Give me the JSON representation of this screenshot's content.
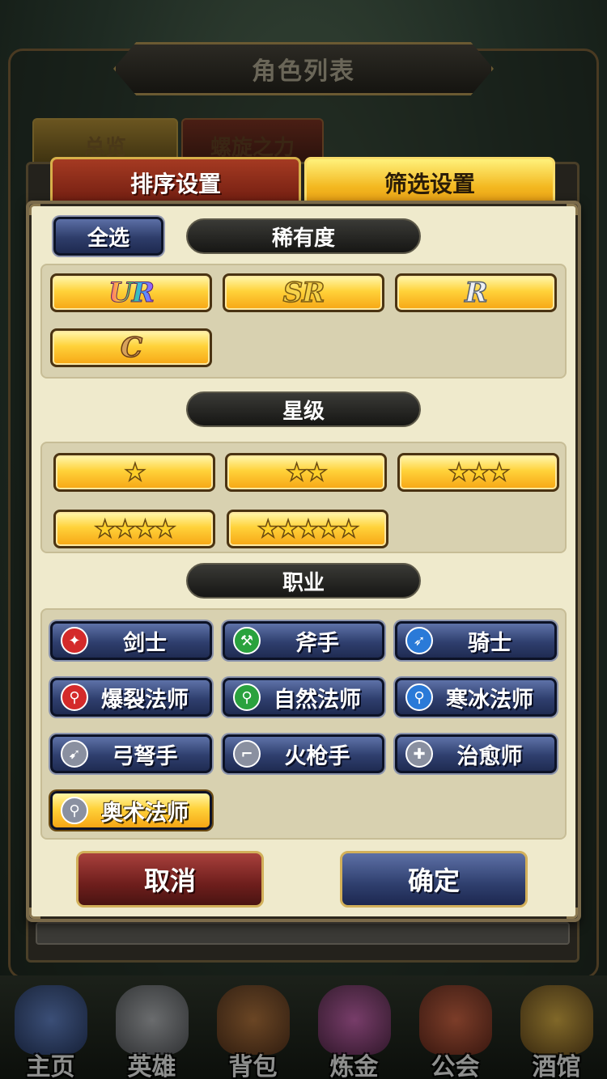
{
  "header": {
    "title": "角色列表"
  },
  "background_tabs": [
    {
      "label": "总览"
    },
    {
      "label": "螺旋之力"
    }
  ],
  "dialog": {
    "tabs": [
      {
        "label": "排序设置",
        "active": false
      },
      {
        "label": "筛选设置",
        "active": true
      }
    ],
    "select_all_label": "全选",
    "rarity": {
      "header": "稀有度",
      "options": [
        {
          "label": "UR",
          "selected": true
        },
        {
          "label": "SR",
          "selected": true
        },
        {
          "label": "R",
          "selected": true
        },
        {
          "label": "C",
          "selected": true
        }
      ]
    },
    "stars": {
      "header": "星级",
      "options": [
        {
          "label": "★",
          "count": 1,
          "selected": true
        },
        {
          "label": "★★",
          "count": 2,
          "selected": true
        },
        {
          "label": "★★★",
          "count": 3,
          "selected": true
        },
        {
          "label": "★★★★",
          "count": 4,
          "selected": true
        },
        {
          "label": "★★★★★",
          "count": 5,
          "selected": true
        }
      ]
    },
    "classes": {
      "header": "职业",
      "options": [
        {
          "label": "剑士",
          "icon": "sword-icon",
          "color": "#d42a2a",
          "glyph": "✦",
          "selected": false
        },
        {
          "label": "斧手",
          "icon": "axe-icon",
          "color": "#2aa23e",
          "glyph": "⚒",
          "selected": false
        },
        {
          "label": "骑士",
          "icon": "lance-icon",
          "color": "#2a7ad8",
          "glyph": "➶",
          "selected": false
        },
        {
          "label": "爆裂法师",
          "icon": "red-staff-icon",
          "color": "#d42a2a",
          "glyph": "⚲",
          "selected": false
        },
        {
          "label": "自然法师",
          "icon": "green-staff-icon",
          "color": "#2aa23e",
          "glyph": "⚲",
          "selected": false
        },
        {
          "label": "寒冰法师",
          "icon": "blue-staff-icon",
          "color": "#2a7ad8",
          "glyph": "⚲",
          "selected": false
        },
        {
          "label": "弓弩手",
          "icon": "bow-icon",
          "color": "#8a90a0",
          "glyph": "➹",
          "selected": false
        },
        {
          "label": "火枪手",
          "icon": "gun-icon",
          "color": "#8a90a0",
          "glyph": "⌐",
          "selected": false
        },
        {
          "label": "治愈师",
          "icon": "heal-staff-icon",
          "color": "#8a90a0",
          "glyph": "✚",
          "selected": false
        },
        {
          "label": "奥术法师",
          "icon": "arcane-staff-icon",
          "color": "#8a90a0",
          "glyph": "⚲",
          "selected": true
        }
      ]
    },
    "cancel_label": "取消",
    "confirm_label": "确定"
  },
  "bottom_nav": [
    {
      "label": "主页",
      "icon": "castle-icon",
      "color": "#3a5aa8"
    },
    {
      "label": "英雄",
      "icon": "knight-helmet-icon",
      "color": "#8a8a90"
    },
    {
      "label": "背包",
      "icon": "backpack-icon",
      "color": "#8a4a22"
    },
    {
      "label": "炼金",
      "icon": "potion-flask-icon",
      "color": "#a03a8a"
    },
    {
      "label": "公会",
      "icon": "guild-shield-icon",
      "color": "#a83a2a"
    },
    {
      "label": "酒馆",
      "icon": "beer-mug-icon",
      "color": "#a07a2a"
    }
  ]
}
